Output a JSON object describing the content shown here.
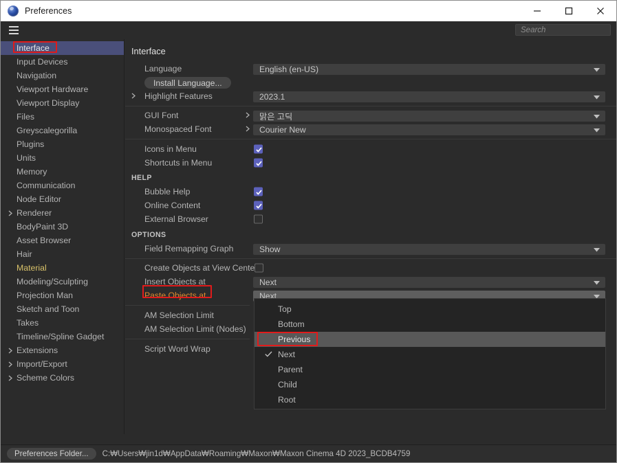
{
  "window": {
    "title": "Preferences",
    "app_icon": "cinema4d-logo-icon",
    "minimize": "minimize-icon",
    "maximize": "maximize-icon",
    "close": "close-icon"
  },
  "menustrip": {
    "hamburger": "hamburger-menu-icon",
    "search_placeholder": "Search",
    "search_value": ""
  },
  "sidebar": {
    "items": [
      {
        "label": "Interface",
        "expandable": false,
        "selected": true,
        "accent": false
      },
      {
        "label": "Input Devices",
        "expandable": false,
        "selected": false,
        "accent": false
      },
      {
        "label": "Navigation",
        "expandable": false,
        "selected": false,
        "accent": false
      },
      {
        "label": "Viewport Hardware",
        "expandable": false,
        "selected": false,
        "accent": false
      },
      {
        "label": "Viewport Display",
        "expandable": false,
        "selected": false,
        "accent": false
      },
      {
        "label": "Files",
        "expandable": false,
        "selected": false,
        "accent": false
      },
      {
        "label": "Greyscalegorilla",
        "expandable": false,
        "selected": false,
        "accent": false
      },
      {
        "label": "Plugins",
        "expandable": false,
        "selected": false,
        "accent": false
      },
      {
        "label": "Units",
        "expandable": false,
        "selected": false,
        "accent": false
      },
      {
        "label": "Memory",
        "expandable": false,
        "selected": false,
        "accent": false
      },
      {
        "label": "Communication",
        "expandable": false,
        "selected": false,
        "accent": false
      },
      {
        "label": "Node Editor",
        "expandable": false,
        "selected": false,
        "accent": false
      },
      {
        "label": "Renderer",
        "expandable": true,
        "selected": false,
        "accent": false
      },
      {
        "label": "BodyPaint 3D",
        "expandable": false,
        "selected": false,
        "accent": false
      },
      {
        "label": "Asset Browser",
        "expandable": false,
        "selected": false,
        "accent": false
      },
      {
        "label": "Hair",
        "expandable": false,
        "selected": false,
        "accent": false
      },
      {
        "label": "Material",
        "expandable": false,
        "selected": false,
        "accent": true
      },
      {
        "label": "Modeling/Sculpting",
        "expandable": false,
        "selected": false,
        "accent": false
      },
      {
        "label": "Projection Man",
        "expandable": false,
        "selected": false,
        "accent": false
      },
      {
        "label": "Sketch and Toon",
        "expandable": false,
        "selected": false,
        "accent": false
      },
      {
        "label": "Takes",
        "expandable": false,
        "selected": false,
        "accent": false
      },
      {
        "label": "Timeline/Spline Gadget",
        "expandable": false,
        "selected": false,
        "accent": false
      },
      {
        "label": "Extensions",
        "expandable": true,
        "selected": false,
        "accent": false
      },
      {
        "label": "Import/Export",
        "expandable": true,
        "selected": false,
        "accent": false
      },
      {
        "label": "Scheme Colors",
        "expandable": true,
        "selected": false,
        "accent": false
      }
    ]
  },
  "main": {
    "title": "Interface",
    "language": {
      "label": "Language",
      "value": "English (en-US)"
    },
    "install_language": {
      "label": "Install Language..."
    },
    "highlight_features": {
      "label": "Highlight Features",
      "value": "2023.1"
    },
    "gui_font": {
      "label": "GUI Font",
      "value": "맑은 고딕"
    },
    "monospaced_font": {
      "label": "Monospaced Font",
      "value": "Courier New"
    },
    "icons_in_menu": {
      "label": "Icons in Menu",
      "checked": true
    },
    "shortcuts_in_menu": {
      "label": "Shortcuts in Menu",
      "checked": true
    },
    "help_header": "HELP",
    "bubble_help": {
      "label": "Bubble Help",
      "checked": true
    },
    "online_content": {
      "label": "Online Content",
      "checked": true
    },
    "external_browser": {
      "label": "External Browser",
      "checked": false
    },
    "options_header": "OPTIONS",
    "field_remapping_graph": {
      "label": "Field Remapping Graph",
      "value": "Show"
    },
    "create_objects_at_view_center": {
      "label": "Create Objects at View Center",
      "checked": false
    },
    "insert_objects_at": {
      "label": "Insert Objects at",
      "value": "Next"
    },
    "paste_objects_at": {
      "label": "Paste Objects at",
      "value": "Next"
    },
    "am_selection_limit": {
      "label": "AM Selection Limit"
    },
    "am_selection_limit_nodes": {
      "label": "AM Selection Limit (Nodes)"
    },
    "script_word_wrap": {
      "label": "Script Word Wrap"
    }
  },
  "dropdown": {
    "items": [
      {
        "label": "Top",
        "checked": false,
        "hover": false
      },
      {
        "label": "Bottom",
        "checked": false,
        "hover": false
      },
      {
        "label": "Previous",
        "checked": false,
        "hover": true
      },
      {
        "label": "Next",
        "checked": true,
        "hover": false
      },
      {
        "label": "Parent",
        "checked": false,
        "hover": false
      },
      {
        "label": "Child",
        "checked": false,
        "hover": false
      },
      {
        "label": "Root",
        "checked": false,
        "hover": false
      }
    ]
  },
  "statusbar": {
    "button_label": "Preferences Folder...",
    "path": "C:₩Users₩jin1d₩AppData₩Roaming₩Maxon₩Maxon Cinema 4D 2023_BCDB4759"
  },
  "colors": {
    "accent_selection": "#4a4f7a",
    "accent_material": "#d9c26a",
    "accent_orange": "#e08a2e",
    "checkbox_on": "#5c61bb",
    "annotation_red": "#e11b1b",
    "panel_bg": "#2b2b2b",
    "combo_bg": "#3f3f3f"
  }
}
